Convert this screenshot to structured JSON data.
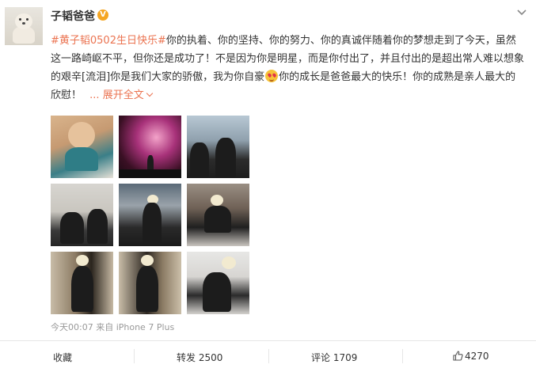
{
  "user": {
    "name": "子韬爸爸",
    "badge": "V"
  },
  "post": {
    "hashtag": "#黄子韬0502生日快乐#",
    "text_1": "你的执着、你的坚持、你的努力、你的真诚伴随着你的梦想走到了今天，虽然这一路崎岖不平，但你还是成功了！不是因为你是明星，而是你付出了，并且付出的是超出常人难以想象的艰辛[流泪]你是我们大家的骄傲，我为你自豪",
    "text_2": "你的成长是爸爸最大的快乐！你的成熟是亲人最大的欣慰！",
    "ellipsis": "...",
    "expand_label": "展开全文"
  },
  "meta": {
    "time": "今天00:07",
    "source": "来自 iPhone 7 Plus"
  },
  "actions": {
    "favorite": "收藏",
    "repost": "转发 2500",
    "comment": "评论 1709",
    "like": "4270"
  },
  "colors": {
    "accent": "#eb7350",
    "badge": "#f5a623",
    "meta": "#999999"
  },
  "icons": [
    "menu-chevron-icon",
    "verified-v-icon",
    "emoji-heart-eyes-icon",
    "expand-chevron-icon",
    "thumbs-up-icon"
  ]
}
